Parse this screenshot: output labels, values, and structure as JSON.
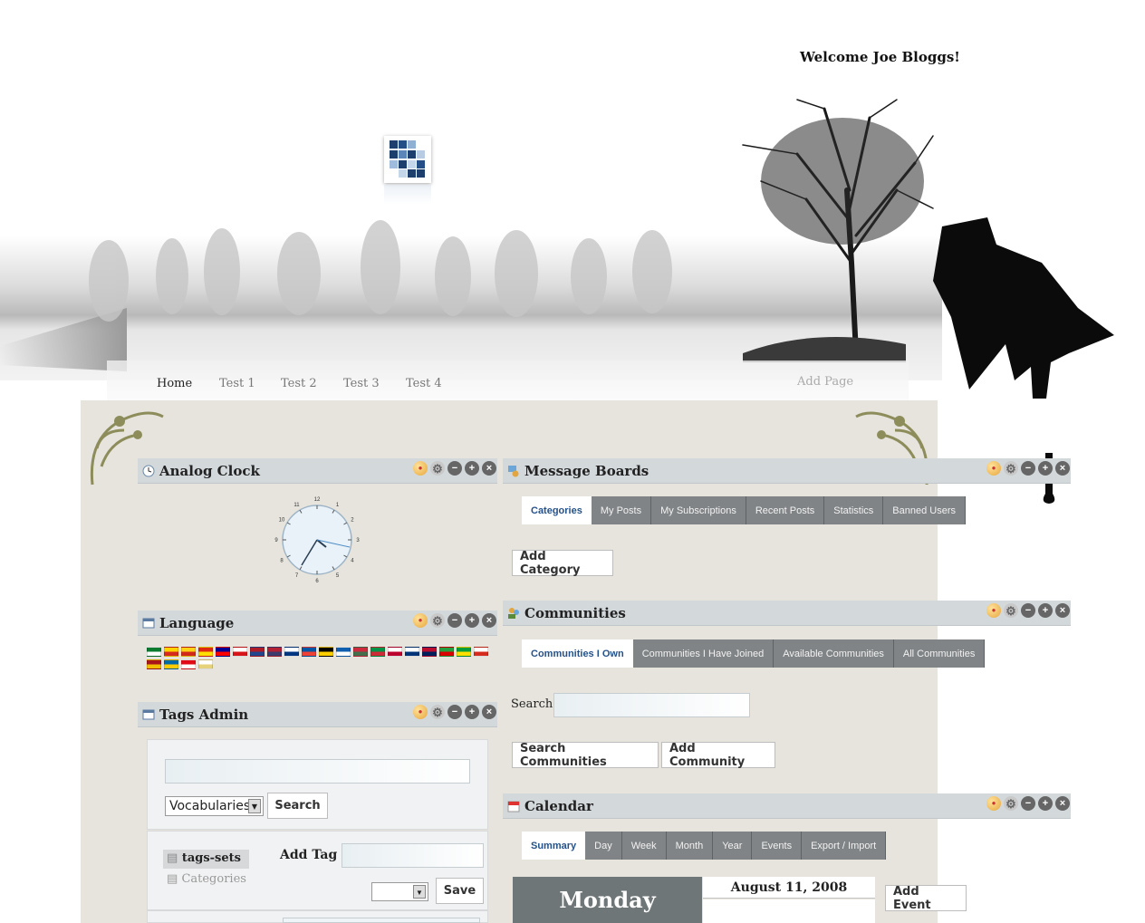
{
  "header": {
    "welcome": "Welcome Joe Bloggs!"
  },
  "nav": {
    "items": [
      "Home",
      "Test 1",
      "Test 2",
      "Test 3",
      "Test 4"
    ],
    "active": "Home",
    "add_page": "Add Page"
  },
  "portlets": {
    "analog_clock": {
      "title": "Analog Clock",
      "clock_numbers": [
        "12",
        "1",
        "2",
        "3",
        "4",
        "5",
        "6",
        "7",
        "8",
        "9",
        "10",
        "11"
      ]
    },
    "language": {
      "title": "Language",
      "flags": [
        {
          "name": "arabic",
          "colors": [
            "#0a7a2e",
            "#ffffff"
          ]
        },
        {
          "name": "catalan-andorra",
          "colors": [
            "#ffd200",
            "#d52b1e"
          ]
        },
        {
          "name": "catalan",
          "colors": [
            "#fcd116",
            "#d12a1a"
          ]
        },
        {
          "name": "chinese",
          "colors": [
            "#de2910",
            "#ffde00"
          ]
        },
        {
          "name": "chinese-taiwan",
          "colors": [
            "#000095",
            "#fe0000"
          ]
        },
        {
          "name": "czech",
          "colors": [
            "#ffffff",
            "#d7141a"
          ]
        },
        {
          "name": "dutch",
          "colors": [
            "#ae1c28",
            "#21468b"
          ]
        },
        {
          "name": "english",
          "colors": [
            "#b22234",
            "#3c3b6e"
          ]
        },
        {
          "name": "finnish",
          "colors": [
            "#ffffff",
            "#003580"
          ]
        },
        {
          "name": "french",
          "colors": [
            "#0055a4",
            "#ef4135"
          ]
        },
        {
          "name": "german",
          "colors": [
            "#000000",
            "#ffce00"
          ]
        },
        {
          "name": "greek",
          "colors": [
            "#0d5eaf",
            "#ffffff"
          ]
        },
        {
          "name": "hungarian",
          "colors": [
            "#cd2a3e",
            "#436f4d"
          ]
        },
        {
          "name": "italian",
          "colors": [
            "#009246",
            "#ce2b37"
          ]
        },
        {
          "name": "japanese",
          "colors": [
            "#ffffff",
            "#bc002d"
          ]
        },
        {
          "name": "korean",
          "colors": [
            "#ffffff",
            "#003478"
          ]
        },
        {
          "name": "norwegian",
          "colors": [
            "#ba0c2f",
            "#00205b"
          ]
        },
        {
          "name": "persian",
          "colors": [
            "#239f40",
            "#da0000"
          ]
        },
        {
          "name": "portuguese",
          "colors": [
            "#009c3b",
            "#ffdf00"
          ]
        },
        {
          "name": "russian",
          "colors": [
            "#ffffff",
            "#d52b1e"
          ]
        },
        {
          "name": "spanish",
          "colors": [
            "#aa151b",
            "#f1bf00"
          ]
        },
        {
          "name": "swedish",
          "colors": [
            "#006aa7",
            "#fecc00"
          ]
        },
        {
          "name": "turkish",
          "colors": [
            "#e30a17",
            "#ffffff"
          ]
        },
        {
          "name": "vietnamese",
          "colors": [
            "#ffffff",
            "#e6d27a"
          ]
        }
      ]
    },
    "tags_admin": {
      "title": "Tags Admin",
      "search_value": "",
      "vocab_select": "Vocabularies",
      "search_button": "Search",
      "sets": [
        "tags-sets",
        "Categories"
      ],
      "add_tag_label": "Add Tag",
      "add_tag_value": "",
      "save_button": "Save"
    },
    "message_boards": {
      "title": "Message Boards",
      "tabs": [
        "Categories",
        "My Posts",
        "My Subscriptions",
        "Recent Posts",
        "Statistics",
        "Banned Users"
      ],
      "add_category": "Add Category"
    },
    "communities": {
      "title": "Communities",
      "tabs": [
        "Communities I Own",
        "Communities I Have Joined",
        "Available Communities",
        "All Communities"
      ],
      "search_label": "Search",
      "search_value": "",
      "search_button": "Search Communities",
      "add_button": "Add Community"
    },
    "calendar": {
      "title": "Calendar",
      "tabs": [
        "Summary",
        "Day",
        "Week",
        "Month",
        "Year",
        "Events",
        "Export / Import"
      ],
      "weekday": "Monday",
      "date": "August 11, 2008",
      "add_event": "Add Event"
    }
  },
  "colors": {
    "portlet_header": "#d3d8db",
    "tab_bg": "#808486",
    "active_tab_text": "#25528a",
    "content_bg": "#e6e4dc"
  }
}
